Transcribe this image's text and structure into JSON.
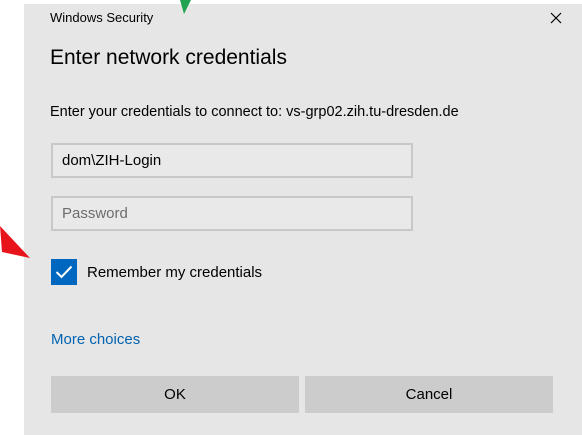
{
  "window": {
    "title": "Windows Security",
    "close_symbol": "✕"
  },
  "dialog": {
    "heading": "Enter network credentials",
    "description": "Enter your credentials to connect to: vs-grp02.zih.tu-dresden.de"
  },
  "username": {
    "value": "dom\\ZIH-Login",
    "placeholder": ""
  },
  "password": {
    "value": "",
    "placeholder": "Password"
  },
  "remember": {
    "label": "Remember my credentials",
    "checked": true
  },
  "more_choices_label": "More choices",
  "buttons": {
    "ok_label": "OK",
    "cancel_label": "Cancel"
  },
  "annotations": {
    "red_arrow_icon": "arrow-red-icon",
    "green_arrow_icon": "arrow-green-icon"
  },
  "colors": {
    "dialog_background": "#e6e6e6",
    "accent": "#0067c0",
    "link": "#0063b1",
    "button_background": "#cccccc",
    "red_arrow": "#e8141b",
    "green_arrow": "#1fa351"
  }
}
